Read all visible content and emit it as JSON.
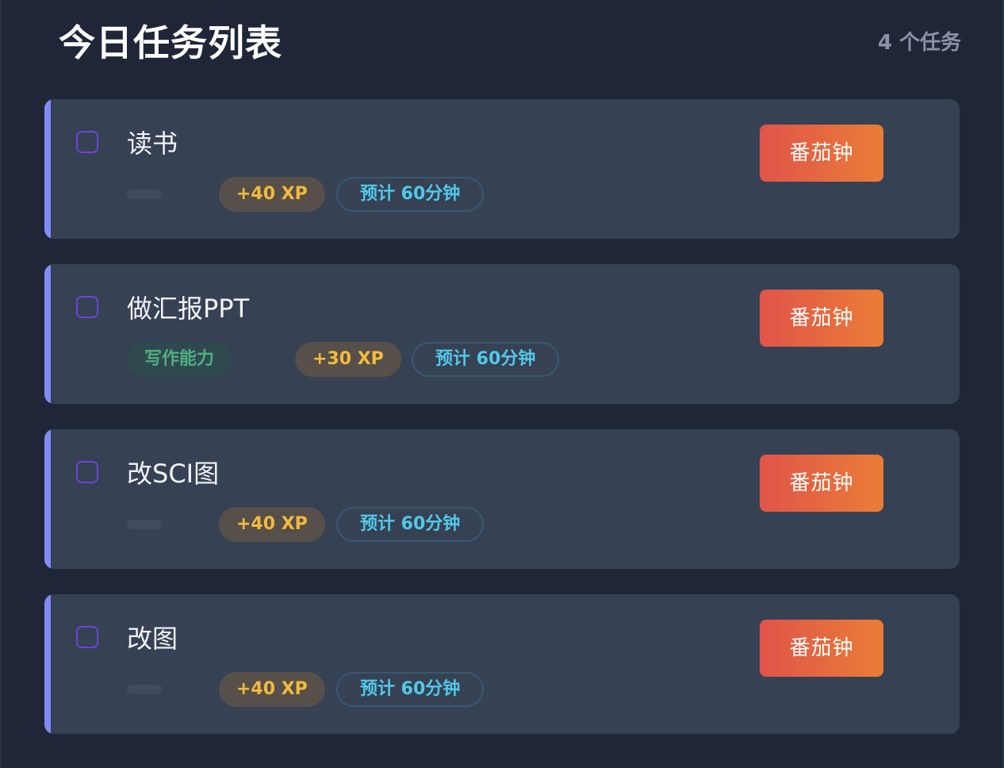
{
  "header": {
    "title": "今日任务列表",
    "task_count": "4 个任务"
  },
  "colors": {
    "background": "#1f2637",
    "card": "#364154",
    "accent_bar": "#818cf8",
    "checkbox_border": "#6d43d8",
    "xp_text": "#f3bb3d",
    "estimate_text": "#52c9e8",
    "skill_text": "#4fae7f",
    "pomodoro_gradient_start": "#e0544a",
    "pomodoro_gradient_end": "#ea7d36"
  },
  "tasks": [
    {
      "title": "读书",
      "skill": "",
      "xp": "+40 XP",
      "estimate": "预计 60分钟",
      "pomodoro_label": "番茄钟",
      "checked": false
    },
    {
      "title": "做汇报PPT",
      "skill": "写作能力",
      "xp": "+30 XP",
      "estimate": "预计 60分钟",
      "pomodoro_label": "番茄钟",
      "checked": false
    },
    {
      "title": "改SCI图",
      "skill": "",
      "xp": "+40 XP",
      "estimate": "预计 60分钟",
      "pomodoro_label": "番茄钟",
      "checked": false
    },
    {
      "title": "改图",
      "skill": "",
      "xp": "+40 XP",
      "estimate": "预计 60分钟",
      "pomodoro_label": "番茄钟",
      "checked": false
    }
  ]
}
